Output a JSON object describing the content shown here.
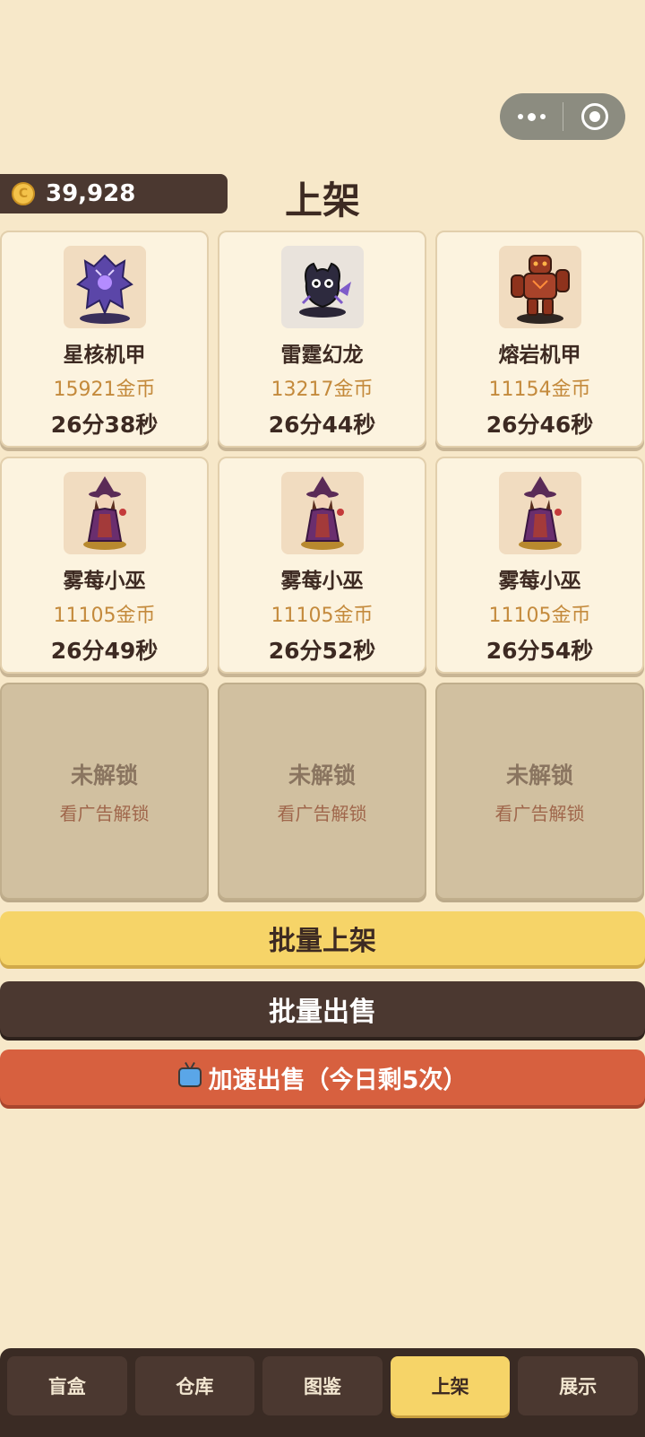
{
  "header": {
    "coins": "39,928",
    "title": "上架"
  },
  "slots": [
    {
      "name": "星核机甲",
      "price": "15921金币",
      "timer": "26分38秒",
      "icon": "mecha-figure-purple"
    },
    {
      "name": "雷霆幻龙",
      "price": "13217金币",
      "timer": "26分44秒",
      "icon": "dragon-figure-dark"
    },
    {
      "name": "熔岩机甲",
      "price": "11154金币",
      "timer": "26分46秒",
      "icon": "golem-figure-lava"
    },
    {
      "name": "雾莓小巫",
      "price": "11105金币",
      "timer": "26分49秒",
      "icon": "witch-figure"
    },
    {
      "name": "雾莓小巫",
      "price": "11105金币",
      "timer": "26分52秒",
      "icon": "witch-figure"
    },
    {
      "name": "雾莓小巫",
      "price": "11105金币",
      "timer": "26分54秒",
      "icon": "witch-figure"
    }
  ],
  "locked_slots": [
    {
      "title": "未解锁",
      "sub": "看广告解锁"
    },
    {
      "title": "未解锁",
      "sub": "看广告解锁"
    },
    {
      "title": "未解锁",
      "sub": "看广告解锁"
    }
  ],
  "actions": {
    "batch_list": "批量上架",
    "batch_sell": "批量出售",
    "speed_sell": "加速出售（今日剩5次）"
  },
  "nav": [
    {
      "label": "盲盒"
    },
    {
      "label": "仓库"
    },
    {
      "label": "图鉴"
    },
    {
      "label": "上架",
      "active": true
    },
    {
      "label": "展示"
    }
  ],
  "colors": {
    "background": "#f7e8c9",
    "accent_yellow": "#f6d468",
    "dark_brown": "#4b3830",
    "speed_red": "#d7603f",
    "price_gold": "#c48a3c"
  }
}
